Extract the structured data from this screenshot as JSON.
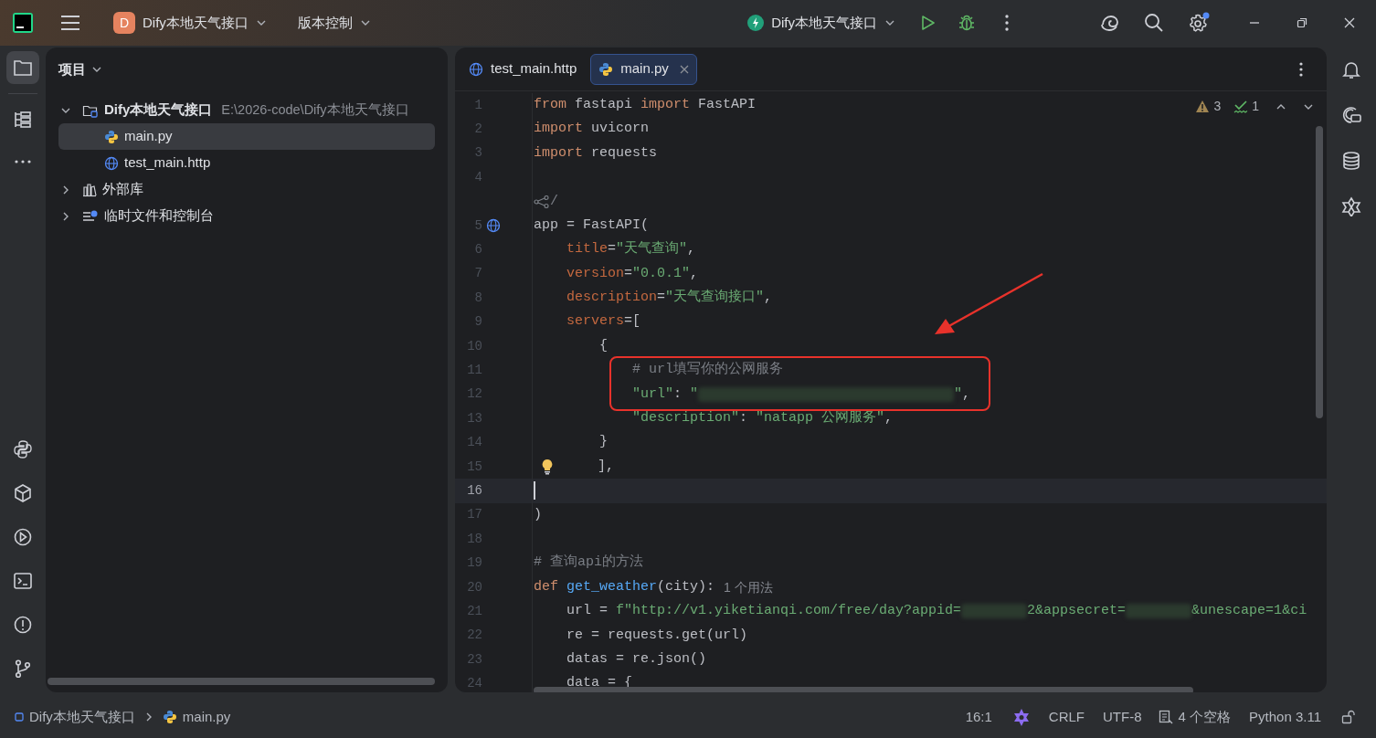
{
  "top_bar": {
    "project_badge": "D",
    "project": "Dify本地天气接口",
    "vcs": "版本控制",
    "run_config": "Dify本地天气接口"
  },
  "project_panel": {
    "title": "项目",
    "tree": [
      {
        "label": "Dify本地天气接口",
        "path": "E:\\2026-code\\Dify本地天气接口",
        "kind": "project",
        "expanded": true,
        "selected": false,
        "children": [
          {
            "label": "main.py",
            "kind": "python",
            "selected": true
          },
          {
            "label": "test_main.http",
            "kind": "http",
            "selected": false
          }
        ]
      },
      {
        "label": "外部库",
        "kind": "library",
        "expanded": false,
        "selected": false
      },
      {
        "label": "临时文件和控制台",
        "kind": "scratch",
        "expanded": false,
        "selected": false
      }
    ]
  },
  "editor": {
    "tabs": [
      {
        "label": "test_main.http",
        "kind": "http",
        "selected": false
      },
      {
        "label": "main.py",
        "kind": "python",
        "selected": true
      }
    ],
    "warnings": "3",
    "weak_warnings": "1",
    "lines": [
      {
        "kind": "code",
        "num": "1",
        "current": false,
        "tokens": [
          {
            "kind": "kw",
            "t": "from"
          },
          {
            "kind": "plain",
            "t": " fastapi "
          },
          {
            "kind": "kw",
            "t": "import"
          },
          {
            "kind": "plain",
            "t": " FastAPI"
          }
        ]
      },
      {
        "kind": "code",
        "num": "2",
        "current": false,
        "tokens": [
          {
            "kind": "kw",
            "t": "import"
          },
          {
            "kind": "plain",
            "t": " uvicorn"
          }
        ]
      },
      {
        "kind": "code",
        "num": "3",
        "current": false,
        "tokens": [
          {
            "kind": "kw",
            "t": "import"
          },
          {
            "kind": "plain",
            "t": " requests"
          }
        ]
      },
      {
        "kind": "code",
        "num": "4",
        "current": false
      },
      {
        "kind": "inlay",
        "tokens": [
          {
            "kind": "comment",
            "t": "/"
          }
        ]
      },
      {
        "kind": "code",
        "num": "5",
        "current": false,
        "gutter": {
          "kind": "globe"
        },
        "tokens": [
          {
            "kind": "plain",
            "t": "app = FastAPI("
          }
        ]
      },
      {
        "kind": "code",
        "num": "6",
        "current": false,
        "tokens": [
          {
            "kind": "arg",
            "t": "    title"
          },
          {
            "kind": "plain",
            "t": "="
          },
          {
            "kind": "str",
            "t": "\"天气查询\""
          },
          {
            "kind": "plain",
            "t": ","
          }
        ]
      },
      {
        "kind": "code",
        "num": "7",
        "current": false,
        "tokens": [
          {
            "kind": "arg",
            "t": "    version"
          },
          {
            "kind": "plain",
            "t": "="
          },
          {
            "kind": "str",
            "t": "\"0.0.1\""
          },
          {
            "kind": "plain",
            "t": ","
          }
        ]
      },
      {
        "kind": "code",
        "num": "8",
        "current": false,
        "tokens": [
          {
            "kind": "arg",
            "t": "    description"
          },
          {
            "kind": "plain",
            "t": "="
          },
          {
            "kind": "str",
            "t": "\"天气查询接口\""
          },
          {
            "kind": "plain",
            "t": ","
          }
        ]
      },
      {
        "kind": "code",
        "num": "9",
        "current": false,
        "tokens": [
          {
            "kind": "arg",
            "t": "    servers"
          },
          {
            "kind": "plain",
            "t": "=["
          }
        ]
      },
      {
        "kind": "code",
        "num": "10",
        "current": false,
        "tokens": [
          {
            "kind": "plain",
            "t": "        {"
          }
        ]
      },
      {
        "kind": "code",
        "num": "11",
        "current": false,
        "tokens": [
          {
            "kind": "comment",
            "t": "            # url填写你的公网服务"
          }
        ]
      },
      {
        "kind": "code",
        "num": "12",
        "current": false,
        "tokens": [
          {
            "kind": "str",
            "t": "            \"url\""
          },
          {
            "kind": "plain",
            "t": ": "
          },
          {
            "kind": "str",
            "t": "\""
          },
          {
            "kind": "redact_long"
          },
          {
            "kind": "str",
            "t": "\""
          },
          {
            "kind": "plain",
            "t": ","
          }
        ]
      },
      {
        "kind": "code",
        "num": "13",
        "current": false,
        "tokens": [
          {
            "kind": "str",
            "t": "            \"description\""
          },
          {
            "kind": "plain",
            "t": ": "
          },
          {
            "kind": "str",
            "t": "\"natapp 公网服务\""
          },
          {
            "kind": "plain",
            "t": ","
          }
        ]
      },
      {
        "kind": "code",
        "num": "14",
        "current": false,
        "tokens": [
          {
            "kind": "plain",
            "t": "        }"
          }
        ]
      },
      {
        "kind": "code",
        "num": "15",
        "current": false,
        "gutter": {
          "kind": "bulb"
        },
        "tokens": [
          {
            "kind": "plain",
            "t": "    ],"
          }
        ]
      },
      {
        "kind": "code",
        "num": "16",
        "current": true
      },
      {
        "kind": "code",
        "num": "17",
        "current": false,
        "tokens": [
          {
            "kind": "plain",
            "t": ")"
          }
        ]
      },
      {
        "kind": "code",
        "num": "18",
        "current": false
      },
      {
        "kind": "code",
        "num": "19",
        "current": false,
        "tokens": [
          {
            "kind": "comment",
            "t": "# 查询api的方法"
          }
        ]
      },
      {
        "kind": "code",
        "num": "20",
        "current": false,
        "tokens": [
          {
            "kind": "kw",
            "t": "def "
          },
          {
            "kind": "fn",
            "t": "get_weather"
          },
          {
            "kind": "plain",
            "t": "(city):"
          },
          {
            "kind": "hint",
            "t": "1 个用法"
          }
        ]
      },
      {
        "kind": "code",
        "num": "21",
        "current": false,
        "tokens": [
          {
            "kind": "plain",
            "t": "    url = "
          },
          {
            "kind": "str",
            "t": "f\"http://v1.yiketianqi.com/free/day?appid="
          },
          {
            "kind": "redact_short"
          },
          {
            "kind": "str",
            "t": "2&appsecret="
          },
          {
            "kind": "redact_short"
          },
          {
            "kind": "str",
            "t": "&unescape=1&ci"
          }
        ]
      },
      {
        "kind": "code",
        "num": "22",
        "current": false,
        "tokens": [
          {
            "kind": "plain",
            "t": "    re = requests.get(url)"
          }
        ]
      },
      {
        "kind": "code",
        "num": "23",
        "current": false,
        "tokens": [
          {
            "kind": "plain",
            "t": "    datas = re.json()"
          }
        ]
      },
      {
        "kind": "code",
        "num": "24",
        "current": false,
        "tokens": [
          {
            "kind": "plain",
            "t": "    data = {"
          }
        ]
      }
    ]
  },
  "status_bar": {
    "breadcrumbs": [
      {
        "label": "Dify本地天气接口",
        "kind": "module"
      },
      {
        "label": "main.py",
        "kind": "python"
      }
    ],
    "position": "16:1",
    "line_ending": "CRLF",
    "encoding": "UTF-8",
    "indent": "4 个空格",
    "interpreter": "Python 3.11"
  }
}
